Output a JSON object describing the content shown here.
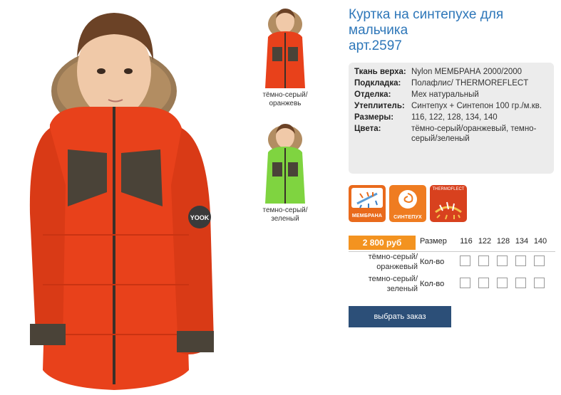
{
  "product": {
    "title_line1": "Куртка на синтепухе для",
    "title_line2": "мальчика",
    "article": "арт.2597"
  },
  "photo": {
    "main_alt": "boy-in-orange-jacket",
    "patch_text": "YOOK"
  },
  "thumbnails": [
    {
      "label": "тёмно-серый/оранжевь",
      "jacket_color": "#e8411b",
      "accent": "#4a4338"
    },
    {
      "label": "темно-серый/зеленый",
      "jacket_color": "#7fd440",
      "accent": "#4a4338"
    }
  ],
  "specs": [
    {
      "key": "Ткань верха:",
      "value": "Nylon МЕМБРАНА 2000/2000"
    },
    {
      "key": "Подкладка:",
      "value": "Полафлис/ THERMOREFLECT"
    },
    {
      "key": "Отделка:",
      "value": "Мех натуральный"
    },
    {
      "key": "Утеплитель:",
      "value": "Синтепух + Синтепон 100 гр./м.кв."
    },
    {
      "key": "Размеры:",
      "value": "116, 122, 128, 134, 140"
    },
    {
      "key": "Цвета:",
      "value": "тёмно-серый/оранжевый, темно-серый/зеленый"
    }
  ],
  "tech_icons": [
    {
      "name": "membrana",
      "label": "МЕМБРАНА"
    },
    {
      "name": "sintepuh",
      "label": "СИНТЕПУХ"
    },
    {
      "name": "thermoreflect",
      "label": "",
      "top_label": "THERMOFLECT"
    }
  ],
  "order": {
    "price": "2 800 руб",
    "size_label": "Размер",
    "sizes": [
      "116",
      "122",
      "128",
      "134",
      "140"
    ],
    "qty_label": "Кол-во",
    "colors": [
      "тёмно-серый/оранжевый",
      "темно-серый/зеленый"
    ],
    "button_label": "выбрать заказ"
  },
  "colors": {
    "title": "#2e77b9",
    "price_bg": "#f39320",
    "button_bg": "#2c4f78",
    "jacket": "#e8411b"
  }
}
